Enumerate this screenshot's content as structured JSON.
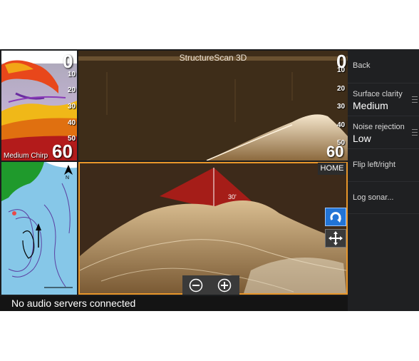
{
  "structure_pane": {
    "title": "StructureScan 3D",
    "depth_top": "0",
    "depth_bottom": "60",
    "ticks": [
      "10",
      "20",
      "30",
      "40",
      "50"
    ]
  },
  "sonar_pane": {
    "depth_top": "0",
    "depth_bottom": "60",
    "ticks": [
      "10",
      "20",
      "30",
      "40",
      "50"
    ],
    "mode_label": "Medium Chirp"
  },
  "scan3d_pane": {
    "home_label": "HOME",
    "depth_marker": "30'"
  },
  "status_bar": {
    "message": "No audio servers connected"
  },
  "menu": {
    "back": "Back",
    "surface_clarity": {
      "label": "Surface clarity",
      "value": "Medium"
    },
    "noise_rejection": {
      "label": "Noise rejection",
      "value": "Low"
    },
    "flip": "Flip left/right",
    "log": "Log sonar..."
  },
  "icons": {
    "rotate": "rotate-icon",
    "pan": "pan-arrows-icon",
    "zoom_out": "minus-circle-icon",
    "zoom_in": "plus-circle-icon",
    "scroll": "drag-grip-icon"
  },
  "colors": {
    "active_border": "#e8962a",
    "active_button": "#2274d6",
    "menu_bg": "#1f2022"
  }
}
